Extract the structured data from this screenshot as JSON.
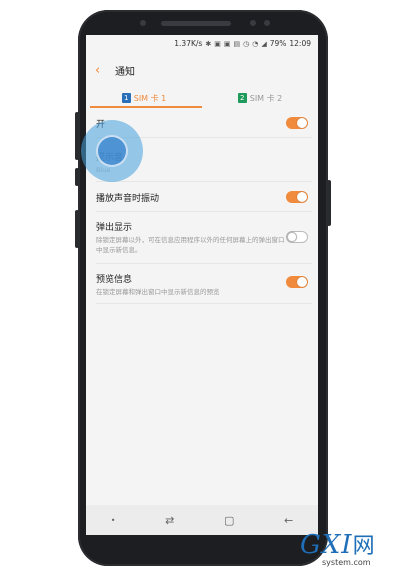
{
  "status_bar": {
    "speed": "1.37K/s",
    "battery": "79%",
    "time": "12:09"
  },
  "header": {
    "title": "通知"
  },
  "tabs": [
    {
      "badge": "1",
      "label": "SIM 卡 1",
      "color": "#2a6fb8",
      "active": true
    },
    {
      "badge": "2",
      "label": "SIM 卡 2",
      "color": "#1e9a5a",
      "active": false
    }
  ],
  "settings": [
    {
      "title": "开",
      "subtitle": "",
      "switch": "on"
    },
    {
      "title": "提示音",
      "subtitle": "Blue",
      "switch": ""
    },
    {
      "title": "播放声音时振动",
      "subtitle": "",
      "switch": "on"
    },
    {
      "title": "弹出显示",
      "subtitle": "除锁定屏幕以外，可在信息应用程序以外的任何屏幕上的弹出窗口中显示新信息。",
      "switch": "off"
    },
    {
      "title": "预览信息",
      "subtitle": "在锁定屏幕和弹出窗口中显示新信息的预览",
      "switch": "on"
    }
  ],
  "nav": {
    "dot": "•",
    "recent": "⇄",
    "home": "▢",
    "back": "←"
  },
  "watermark": {
    "main": "GXI",
    "wang": "网",
    "sub": "system.com"
  },
  "colors": {
    "accent": "#f08a3c"
  }
}
